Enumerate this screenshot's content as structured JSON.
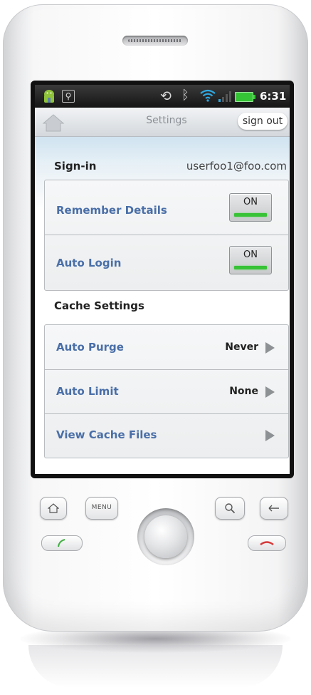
{
  "status_bar": {
    "time": "6:31",
    "icons": [
      "android-icon",
      "usb-icon",
      "sync-icon",
      "bluetooth-icon",
      "wifi-icon",
      "signal-icon",
      "battery-icon"
    ]
  },
  "title_bar": {
    "title": "Settings",
    "signout_label": "sign out",
    "home_icon": "home-icon"
  },
  "signin": {
    "label": "Sign-in",
    "value": "userfoo1@foo.com"
  },
  "signin_settings": [
    {
      "label": "Remember Details",
      "toggle": "ON"
    },
    {
      "label": "Auto Login",
      "toggle": "ON"
    }
  ],
  "cache_section": {
    "title": "Cache Settings",
    "items": [
      {
        "label": "Auto Purge",
        "value": "Never"
      },
      {
        "label": "Auto Limit",
        "value": "None"
      },
      {
        "label": "View Cache Files",
        "value": ""
      }
    ]
  },
  "hardware_buttons": {
    "menu_label": "MENU",
    "icons": [
      "home-key-icon",
      "menu-key",
      "search-key-icon",
      "back-key-icon",
      "call-icon",
      "end-call-icon",
      "trackball"
    ]
  },
  "colors": {
    "accent_label": "#4a6fa8",
    "toggle_on": "#38c236",
    "status_bar": "#151515"
  }
}
